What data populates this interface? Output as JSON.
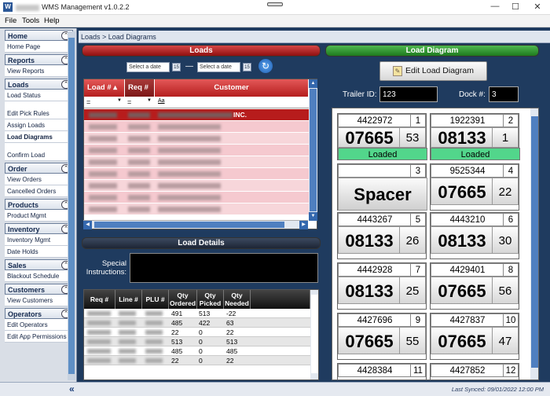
{
  "window": {
    "title": "WMS Management v1.0.2.2",
    "minimize": "—",
    "maximize": "☐",
    "close": "✕"
  },
  "menu": [
    "File",
    "Tools",
    "Help"
  ],
  "nav": [
    {
      "section": "Home",
      "items": [
        "Home Page"
      ]
    },
    {
      "section": "Reports",
      "items": [
        "View Reports"
      ]
    },
    {
      "section": "Loads",
      "items": [
        "Load Status",
        "",
        "Edit Pick Rules",
        "Assign Loads",
        "Load Diagrams",
        "",
        "Confirm Load"
      ]
    },
    {
      "section": "Order",
      "items": [
        "View Orders",
        "Cancelled Orders"
      ]
    },
    {
      "section": "Products",
      "items": [
        "Product Mgmt"
      ]
    },
    {
      "section": "Inventory",
      "items": [
        "Inventory Mgmt",
        "Date Holds"
      ]
    },
    {
      "section": "Sales",
      "items": [
        "Blackout Schedule"
      ]
    },
    {
      "section": "Customers",
      "items": [
        "View Customers"
      ]
    },
    {
      "section": "Operators",
      "items": [
        "Edit Operators",
        "Edit App Permissions"
      ]
    }
  ],
  "breadcrumb": "Loads > Load Diagrams",
  "loads": {
    "header": "Loads",
    "date_placeholder": "Select a date",
    "date_sep": "—",
    "cal_icon": "15",
    "columns": [
      "Load #",
      "Req #",
      "Customer"
    ],
    "filter_op": "=",
    "filter_text": "Aa",
    "selected_customer_suffix": "INC."
  },
  "details": {
    "header": "Load Details",
    "special_label": "Special Instructions:",
    "columns": [
      "Req #",
      "Line #",
      "PLU #",
      "Qty Ordered",
      "Qty Picked",
      "Qty Needed"
    ],
    "rows": [
      {
        "ordered": "491",
        "picked": "513",
        "needed": "-22"
      },
      {
        "ordered": "485",
        "picked": "422",
        "needed": "63"
      },
      {
        "ordered": "22",
        "picked": "0",
        "needed": "22"
      },
      {
        "ordered": "513",
        "picked": "0",
        "needed": "513"
      },
      {
        "ordered": "485",
        "picked": "0",
        "needed": "485"
      },
      {
        "ordered": "22",
        "picked": "0",
        "needed": "22"
      }
    ]
  },
  "diagram": {
    "header": "Load Diagram",
    "edit_button": "Edit Load Diagram",
    "trailer_label": "Trailer ID:",
    "trailer_value": "123",
    "dock_label": "Dock #:",
    "dock_value": "3",
    "cards": [
      {
        "id": "4422972",
        "pos": "1",
        "plu": "07665",
        "qty": "53",
        "status": "Loaded"
      },
      {
        "id": "1922391",
        "pos": "2",
        "plu": "08133",
        "qty": "1",
        "status": "Loaded"
      },
      {
        "id": "",
        "pos": "3",
        "spacer": "Spacer"
      },
      {
        "id": "9525344",
        "pos": "4",
        "plu": "07665",
        "qty": "22"
      },
      {
        "id": "4443267",
        "pos": "5",
        "plu": "08133",
        "qty": "26"
      },
      {
        "id": "4443210",
        "pos": "6",
        "plu": "08133",
        "qty": "30"
      },
      {
        "id": "4442928",
        "pos": "7",
        "plu": "08133",
        "qty": "25"
      },
      {
        "id": "4429401",
        "pos": "8",
        "plu": "07665",
        "qty": "56"
      },
      {
        "id": "4427696",
        "pos": "9",
        "plu": "07665",
        "qty": "55"
      },
      {
        "id": "4427837",
        "pos": "10",
        "plu": "07665",
        "qty": "47"
      },
      {
        "id": "4428384",
        "pos": "11"
      },
      {
        "id": "4427852",
        "pos": "12"
      }
    ]
  },
  "status": {
    "collapse": "«",
    "last_synced": "Last Synced: 09/01/2022 12:00 PM"
  }
}
